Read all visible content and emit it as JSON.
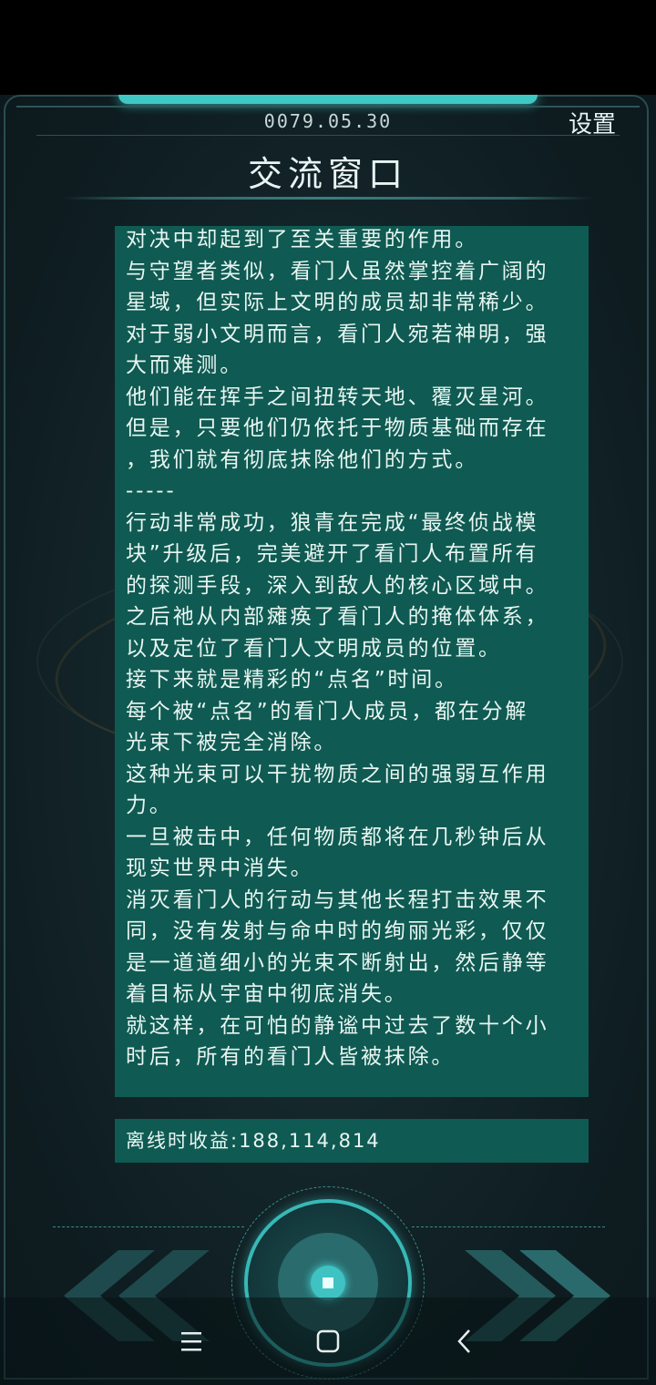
{
  "header": {
    "date": "0079.05.30",
    "settings_label": "设置",
    "title": "交流窗口"
  },
  "story": {
    "lines": [
      "对决中却起到了至关重要的作用。",
      "与守望者类似，看门人虽然掌控着广阔的",
      "星域，但实际上文明的成员却非常稀少。",
      "对于弱小文明而言，看门人宛若神明，强",
      "大而难测。",
      "他们能在挥手之间扭转天地、覆灭星河。",
      "但是，只要他们仍依托于物质基础而存在",
      "，我们就有彻底抹除他们的方式。",
      "-----",
      "行动非常成功，狼青在完成“最终侦战模",
      "块”升级后，完美避开了看门人布置所有",
      "的探测手段，深入到敌人的核心区域中。",
      "之后祂从内部瘫痪了看门人的掩体体系，",
      "以及定位了看门人文明成员的位置。",
      "接下来就是精彩的“点名”时间。",
      "每个被“点名”的看门人成员，都在分解",
      "光束下被完全消除。",
      "这种光束可以干扰物质之间的强弱互作用",
      "力。",
      "一旦被击中，任何物质都将在几秒钟后从",
      "现实世界中消失。",
      "消灭看门人的行动与其他长程打击效果不",
      "同，没有发射与命中时的绚丽光彩，仅仅",
      "是一道道细小的光束不断射出，然后静等",
      "着目标从宇宙中彻底消失。",
      "就这样，在可怕的静谧中过去了数十个小",
      "时后，所有的看门人皆被抹除。"
    ]
  },
  "income": {
    "label": "离线时收益:188,114,814"
  },
  "controls": {
    "left_icon": "double-chevron-left-icon",
    "right_icon": "double-chevron-right-icon",
    "center_icon": "confirm-orb-icon"
  },
  "system_nav": {
    "menu_icon": "menu-icon",
    "home_icon": "home-icon",
    "back_icon": "back-icon"
  },
  "colors": {
    "panel": "#0f5a52",
    "accent": "#3fc7c4",
    "background": "#14272b"
  }
}
